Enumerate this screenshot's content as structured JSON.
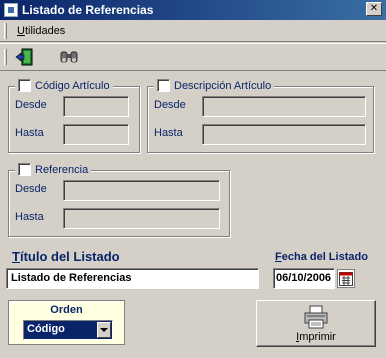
{
  "window": {
    "title": "Listado de Referencias",
    "close_glyph": "✕"
  },
  "menu": {
    "items": [
      {
        "accel": "U",
        "rest": "tilidades"
      }
    ]
  },
  "toolbar": {
    "buttons": [
      {
        "icon": "exit-door-icon"
      },
      {
        "icon": "binoculars-icon"
      }
    ]
  },
  "groups": {
    "codigo": {
      "title": "Código Artículo",
      "desde_label": "Desde",
      "hasta_label": "Hasta",
      "desde_value": "",
      "hasta_value": ""
    },
    "descripcion": {
      "title": "Descripción Artículo",
      "desde_label": "Desde",
      "hasta_label": "Hasta",
      "desde_value": "",
      "hasta_value": ""
    },
    "referencia": {
      "title": "Referencia",
      "desde_label": "Desde",
      "hasta_label": "Hasta",
      "desde_value": "",
      "hasta_value": ""
    }
  },
  "titulo": {
    "label_accel": "T",
    "label_rest": "ítulo del Listado",
    "value": "Listado de Referencias"
  },
  "fecha": {
    "label_accel": "F",
    "label_rest": "echa del Listado",
    "value": "06/10/2006",
    "calendar_icon": "calendar-icon"
  },
  "orden": {
    "title": "Orden",
    "selected": "Código"
  },
  "imprimir": {
    "accel": "I",
    "rest": "mprimir",
    "icon": "printer-icon"
  },
  "colors": {
    "accent": "#0a246a",
    "face": "#d4d0c8",
    "orden_bg": "#ffffe1"
  }
}
